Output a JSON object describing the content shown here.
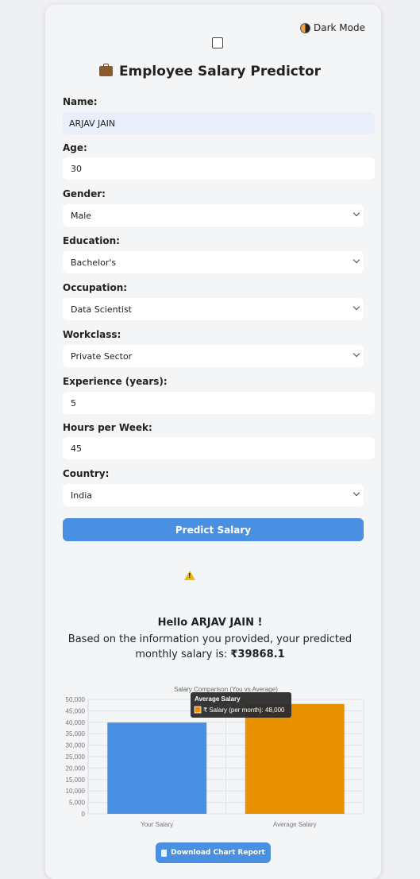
{
  "header": {
    "dark_mode_label": "Dark Mode",
    "title": "Employee Salary Predictor"
  },
  "form": {
    "name_label": "Name:",
    "name_value": "ARJAV JAIN",
    "age_label": "Age:",
    "age_value": "30",
    "gender_label": "Gender:",
    "gender_value": "Male",
    "education_label": "Education:",
    "education_value": "Bachelor's",
    "occupation_label": "Occupation:",
    "occupation_value": "Data Scientist",
    "workclass_label": "Workclass:",
    "workclass_value": "Private Sector",
    "experience_label": "Experience (years):",
    "experience_value": "5",
    "hours_label": "Hours per Week:",
    "hours_value": "45",
    "country_label": "Country:",
    "country_value": "India",
    "predict_label": "Predict Salary"
  },
  "result": {
    "hello": "Hello ARJAV JAIN !",
    "text": "Based on the information you provided, your predicted monthly salary is:",
    "amount": "₹39868.1"
  },
  "chart_data": {
    "type": "bar",
    "title": "Salary Comparison (You vs Average)",
    "categories": [
      "Your Salary",
      "Average Salary"
    ],
    "values": [
      39868.1,
      48000
    ],
    "colors": [
      "#4a90e2",
      "#ea9100"
    ],
    "ylim": [
      0,
      50000
    ],
    "yticks": [
      "0",
      "5,000",
      "10,000",
      "15,000",
      "20,000",
      "25,000",
      "30,000",
      "35,000",
      "40,000",
      "45,000",
      "50,000"
    ],
    "tooltip": {
      "title": "Average Salary",
      "text": "₹ Salary (per month): 48,000"
    }
  },
  "download_label": "Download Chart Report"
}
